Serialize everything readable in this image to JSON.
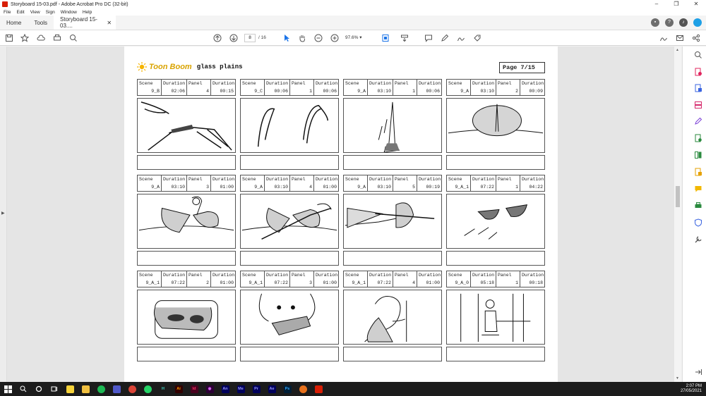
{
  "window": {
    "title": "Storyboard 15-03.pdf - Adobe Acrobat Pro DC (32-bit)",
    "controls": [
      "–",
      "❐",
      "✕"
    ]
  },
  "menu": [
    "File",
    "Edit",
    "View",
    "Sign",
    "Window",
    "Help"
  ],
  "tabs": {
    "home": "Home",
    "tools": "Tools",
    "document": "Storyboard 15-03....",
    "close": "✕"
  },
  "toolbar": {
    "page_current": "8",
    "page_total": "/ 16",
    "zoom": "97.6%"
  },
  "page": {
    "brand": "Toon Boom",
    "project": "glass plains",
    "page_label": "Page  7/15"
  },
  "header_labels": {
    "scene": "Scene",
    "duration": "Duration",
    "panel": "Panel"
  },
  "panels": [
    {
      "scene": "9_B",
      "duration": "02:06",
      "panel": "4",
      "total": "00:15"
    },
    {
      "scene": "9_C",
      "duration": "00:06",
      "panel": "1",
      "total": "00:06"
    },
    {
      "scene": "9_A",
      "duration": "03:10",
      "panel": "1",
      "total": "00:06"
    },
    {
      "scene": "9_A",
      "duration": "03:10",
      "panel": "2",
      "total": "00:09"
    },
    {
      "scene": "9_A",
      "duration": "03:10",
      "panel": "3",
      "total": "01:00"
    },
    {
      "scene": "9_A",
      "duration": "03:10",
      "panel": "4",
      "total": "01:00"
    },
    {
      "scene": "9_A",
      "duration": "03:10",
      "panel": "5",
      "total": "00:19"
    },
    {
      "scene": "9_A_1",
      "duration": "07:22",
      "panel": "1",
      "total": "04:22"
    },
    {
      "scene": "9_A_1",
      "duration": "07:22",
      "panel": "2",
      "total": "01:00"
    },
    {
      "scene": "9_A_1",
      "duration": "07:22",
      "panel": "3",
      "total": "01:00"
    },
    {
      "scene": "9_A_1",
      "duration": "07:22",
      "panel": "4",
      "total": "01:00"
    },
    {
      "scene": "9_A_0",
      "duration": "05:18",
      "panel": "1",
      "total": "00:18"
    }
  ],
  "taskbar": {
    "apps": [
      {
        "name": "Ai",
        "color": "#330000",
        "fg": "#ff9a00"
      },
      {
        "name": "Id",
        "color": "#49021f",
        "fg": "#ff3366"
      },
      {
        "name": "◉",
        "color": "#2d0036",
        "fg": "#e066ff"
      },
      {
        "name": "An",
        "color": "#00005b",
        "fg": "#9999ff"
      },
      {
        "name": "Me",
        "color": "#00005b",
        "fg": "#9999ff"
      },
      {
        "name": "Pr",
        "color": "#00005b",
        "fg": "#9999ff"
      },
      {
        "name": "Ae",
        "color": "#00005b",
        "fg": "#9999ff"
      },
      {
        "name": "Ps",
        "color": "#001e36",
        "fg": "#31a8ff"
      }
    ],
    "time": "2:07 PM",
    "date": "27/05/2021"
  }
}
